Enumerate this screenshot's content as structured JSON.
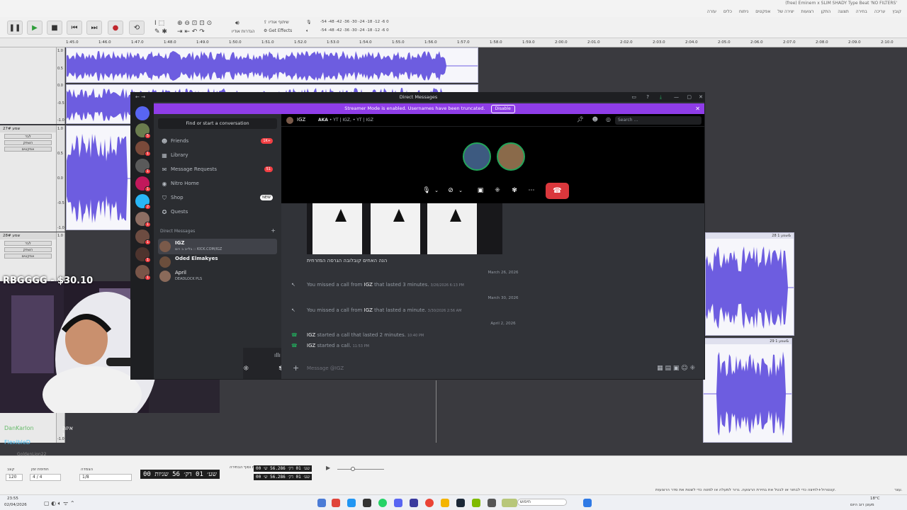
{
  "audacity": {
    "window_title": "(free) Eminem x SLIM SHADY Type Beat 'NO FILTERS'",
    "menu": [
      "קובץ",
      "עריכה",
      "בחירה",
      "תצוגה",
      "התקן",
      "רצועות",
      "יצירה של",
      "אפקטים",
      "ניתוח",
      "כלים",
      "עזרה"
    ],
    "toolbar": {
      "share_label": "שיתוף אודיו",
      "get_effects": "Get Effects",
      "audio_setup": "הגדרות אודיו",
      "meter_ticks": [
        "-54",
        "-48",
        "-42",
        "-36",
        "-30",
        "-24",
        "-18",
        "-12",
        "-6",
        "0"
      ]
    },
    "ruler_ticks": [
      "1:45.0",
      "1:46.0",
      "1:47.0",
      "1:48.0",
      "1:49.0",
      "1:50.0",
      "1:51.0",
      "1:52.0",
      "1:53.0",
      "1:54.0",
      "1:55.0",
      "1:56.0",
      "1:57.0",
      "1:58.0",
      "1:59.0",
      "2:00.0",
      "2:01.0",
      "2:02.0",
      "2:03.0",
      "2:04.0",
      "2:05.0",
      "2:06.0",
      "2:07.0",
      "2:08.0",
      "2:09.0",
      "2:10.0"
    ],
    "tracks": [
      {
        "name": "שמע 27#",
        "mute": "השתק",
        "solo": "לבד",
        "effects": "אפקטים"
      },
      {
        "name": "שמע 28#",
        "mute": "השתק",
        "solo": "לבד",
        "effects": "אפקטים"
      }
    ],
    "clips": [
      {
        "header": "שמע 1 28&"
      },
      {
        "header": "שמע 1 29&"
      }
    ],
    "scale_labels": [
      "1.0",
      "0.5",
      "0.0",
      "-0.5",
      "-1.0"
    ],
    "bottom": {
      "tempo_label": "קצב",
      "tempo_value": "120",
      "time_sig_label": "חתימת זמן",
      "time_sig_value": "4 / 4",
      "snap_label": "הצמדה",
      "snap_value": "1/8",
      "big_time": "00 שע׳ 01 דק׳ 56 שניות",
      "sel_label": "תחילת וסוף הבחירה",
      "sel_start": "00 שע׳ 01 דק׳ 56.286 ש׳",
      "sel_end": "00 שע׳ 01 דק׳ 56.286 ש׳",
      "status_text": "קונטרול+לחיצה כדי לבחור או לבטל את בחירת הרצועה. גרור למעלה או למטה כדי לשנות את סדר הרצועות.",
      "status_right": "עצר."
    },
    "taskbar": {
      "time": "23:55",
      "date": "02/04/2026",
      "weather": "18°C",
      "weather_desc": "מעונן רוב היום",
      "search": "חיפוש"
    }
  },
  "discord": {
    "window_title": "Direct Messages",
    "streamer_banner": "Streamer Mode is enabled. Usernames have been truncated.",
    "disable_label": "Disable",
    "find_placeholder": "Find or start a conversation",
    "nav": [
      {
        "label": "Friends",
        "badge": "1K+"
      },
      {
        "label": "Library",
        "badge": ""
      },
      {
        "label": "Message Requests",
        "badge": "51"
      },
      {
        "label": "Nitro Home",
        "badge": ""
      },
      {
        "label": "Shop",
        "badge": "NEW"
      },
      {
        "label": "Quests",
        "badge": ""
      }
    ],
    "dm_header": "Direct Messages",
    "dms": [
      {
        "name": "IGZ",
        "status": "בלייב ב רום :: KICK.COM/IGZ"
      },
      {
        "name": "Oded Elmakyes",
        "status": ""
      },
      {
        "name": "April",
        "status": "DEADLOCK PLS"
      }
    ],
    "chat": {
      "name": "IGZ",
      "aka_label": "AKA",
      "aka_value": "• YT | IGZ, • YT | IGZ",
      "search_placeholder": "Search ...",
      "image_caption": "הנה האחים קובלובה הגרסה המזרחית",
      "dividers": [
        "March 26, 2026",
        "March 30, 2026",
        "April 2, 2026"
      ],
      "events": [
        {
          "prefix": "You missed a call from",
          "who": "IGZ",
          "suffix": "that lasted 3 minutes.",
          "time": "3/26/2026 6:13 PM"
        },
        {
          "prefix": "You missed a call from",
          "who": "IGZ",
          "suffix": "that lasted a minute.",
          "time": "3/30/2026 2:56 AM"
        },
        {
          "prefix": "",
          "who": "IGZ",
          "suffix": "started a call that lasted 2 minutes.",
          "time": "10:40 PM"
        },
        {
          "prefix": "",
          "who": "IGZ",
          "suffix": "started a call.",
          "time": "11:53 PM"
        }
      ],
      "composer_placeholder": "Message @IGZ"
    }
  },
  "stream": {
    "overlay_text": "RBGGGG - $30.10",
    "chat_lines": [
      {
        "user": "DanKarlon",
        "text": "איזה נ"
      },
      {
        "user": "FlexibleD",
        "text": ""
      },
      {
        "user": "GoldenLion22",
        "text": ""
      }
    ],
    "badge_number": "10"
  },
  "colors": {
    "waveform": "#6d5de0",
    "discord_accent": "#8f3de8",
    "hangup": "#da373c",
    "online": "#23a55a"
  }
}
